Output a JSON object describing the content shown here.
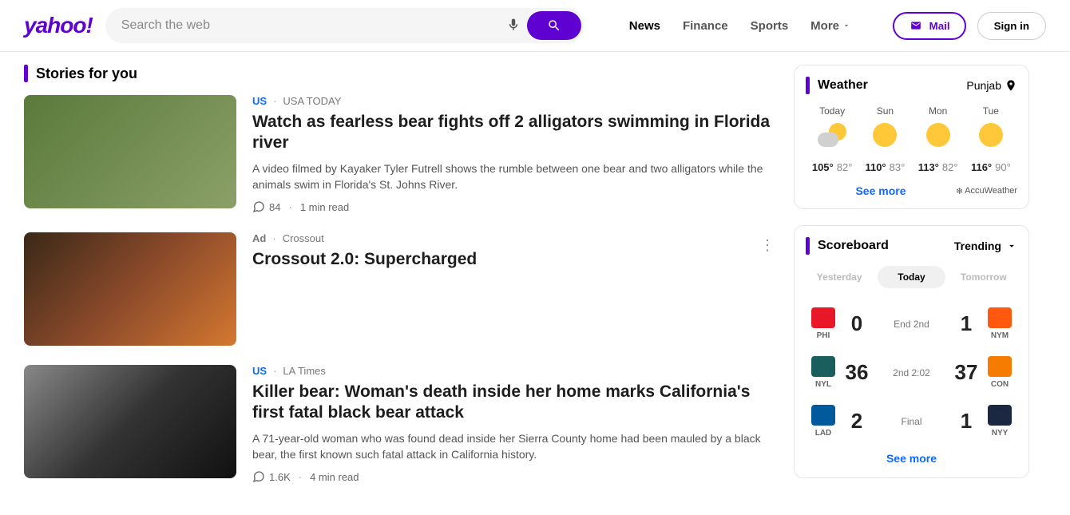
{
  "header": {
    "logo": "yahoo!",
    "search_placeholder": "Search the web",
    "nav": {
      "news": "News",
      "finance": "Finance",
      "sports": "Sports",
      "more": "More"
    },
    "mail": "Mail",
    "signin": "Sign in"
  },
  "stories": {
    "title": "Stories for you",
    "items": [
      {
        "cat": "US",
        "source": "USA TODAY",
        "title": "Watch as fearless bear fights off 2 alligators swimming in Florida river",
        "desc": "A video filmed by Kayaker Tyler Futrell shows the rumble between one bear and two alligators while the animals swim in Florida's St. Johns River.",
        "comments": "84",
        "read": "1 min read"
      },
      {
        "cat": "Ad",
        "source": "Crossout",
        "title": "Crossout 2.0: Supercharged"
      },
      {
        "cat": "US",
        "source": "LA Times",
        "title": "Killer bear: Woman's death inside her home marks California's first fatal black bear attack",
        "desc": "A 71-year-old woman who was found dead inside her Sierra County home had been mauled by a black bear, the first known such fatal attack in California history.",
        "comments": "1.6K",
        "read": "4 min read"
      }
    ]
  },
  "weather": {
    "title": "Weather",
    "location": "Punjab",
    "days": [
      {
        "name": "Today",
        "hi": "105°",
        "lo": "82°",
        "icon": "cloudy"
      },
      {
        "name": "Sun",
        "hi": "110°",
        "lo": "83°",
        "icon": "sun"
      },
      {
        "name": "Mon",
        "hi": "113°",
        "lo": "82°",
        "icon": "sun"
      },
      {
        "name": "Tue",
        "hi": "116°",
        "lo": "90°",
        "icon": "sun"
      }
    ],
    "see_more": "See more",
    "provider": "AccuWeather"
  },
  "scoreboard": {
    "title": "Scoreboard",
    "filter": "Trending",
    "tabs": {
      "yesterday": "Yesterday",
      "today": "Today",
      "tomorrow": "Tomorrow"
    },
    "games": [
      {
        "t1": "PHI",
        "s1": "0",
        "status": "End 2nd",
        "s2": "1",
        "t2": "NYM",
        "l1": "logo-phi",
        "l2": "logo-nym"
      },
      {
        "t1": "NYL",
        "s1": "36",
        "status": "2nd 2:02",
        "s2": "37",
        "t2": "CON",
        "l1": "logo-nyl",
        "l2": "logo-con"
      },
      {
        "t1": "LAD",
        "s1": "2",
        "status": "Final",
        "s2": "1",
        "t2": "NYY",
        "l1": "logo-lad",
        "l2": "logo-nyy"
      }
    ],
    "see_more": "See more"
  }
}
